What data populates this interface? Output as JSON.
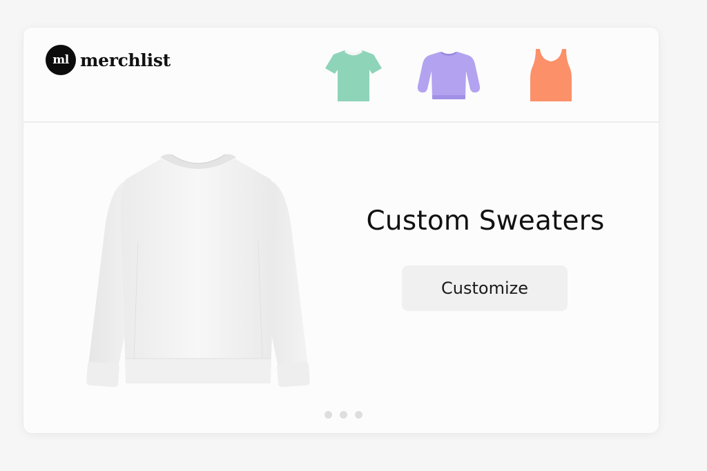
{
  "brand": {
    "logo_mark": "ml",
    "name": "merchlist"
  },
  "categories": [
    {
      "name": "t-shirt",
      "icon": "tshirt-icon",
      "color": "#8ed4b8"
    },
    {
      "name": "sweater",
      "icon": "sweater-icon",
      "color": "#b3a2f0"
    },
    {
      "name": "tank-top",
      "icon": "tank-top-icon",
      "color": "#fb9069"
    }
  ],
  "hero": {
    "title": "Custom Sweaters",
    "cta_label": "Customize",
    "image": "white-sweater-image"
  },
  "carousel": {
    "total_slides": 3,
    "active_index": 0
  }
}
